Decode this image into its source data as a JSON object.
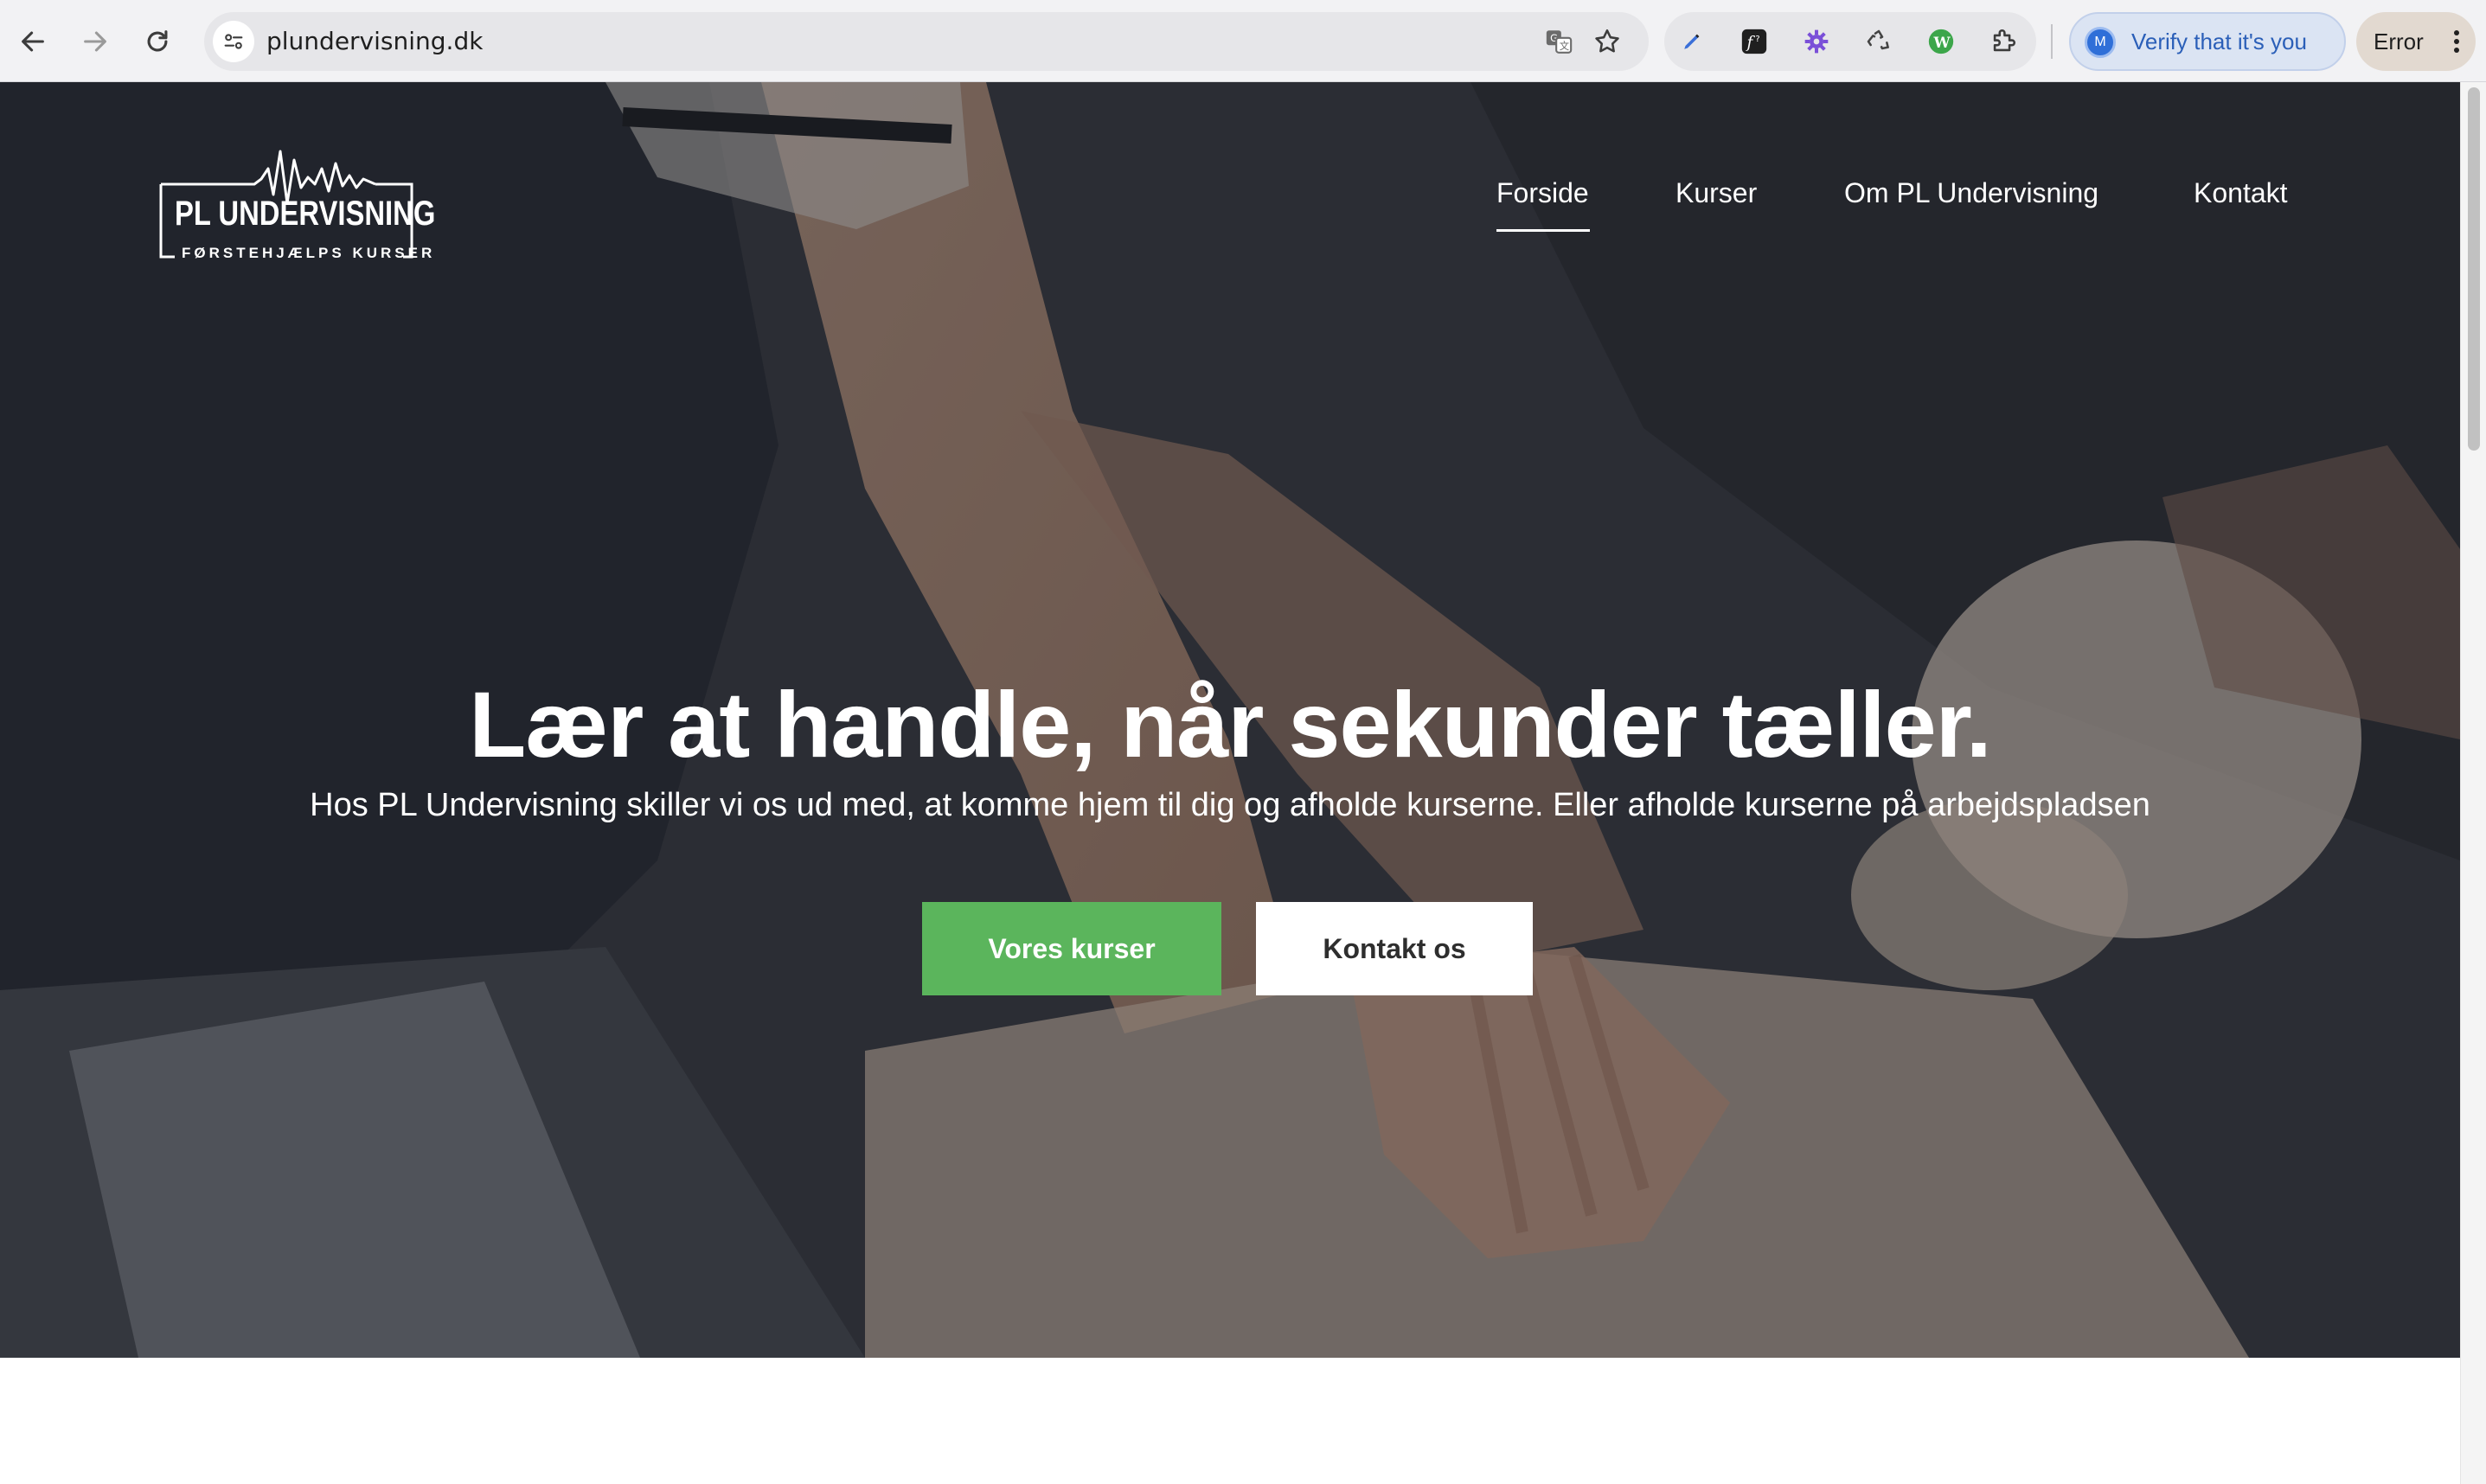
{
  "browser": {
    "url": "plundervisning.dk",
    "verify_label": "Verify that it's you",
    "profile_initial": "M",
    "error_label": "Error",
    "icons": [
      "back-arrow-icon",
      "forward-arrow-icon",
      "reload-icon",
      "site-info-icon",
      "translate-icon",
      "bookmark-star-icon",
      "pen-extension-icon",
      "formula-extension-icon",
      "gear-extension-icon",
      "recycle-extension-icon",
      "wordpress-extension-icon",
      "puzzle-extension-icon",
      "kebab-menu-icon"
    ]
  },
  "site": {
    "logo": {
      "title": "PL UNDERVISNING",
      "subtitle": "FØRSTEHJÆLPS KURSER"
    },
    "nav": [
      {
        "label": "Forside",
        "active": true
      },
      {
        "label": "Kurser",
        "active": false
      },
      {
        "label": "Om PL Undervisning",
        "active": false
      },
      {
        "label": "Kontakt",
        "active": false
      }
    ],
    "hero": {
      "headline": "Lær at handle, når sekunder tæller.",
      "subheadline": "Hos PL Undervisning skiller vi os ud med, at komme hjem til dig og afholde kurserne. Eller afholde kurserne på arbejdspladsen",
      "primary_button": "Vores kurser",
      "secondary_button": "Kontakt os"
    },
    "colors": {
      "primary_button": "#5bb55c",
      "secondary_button": "#ffffff",
      "hero_overlay": "#12141a"
    }
  }
}
